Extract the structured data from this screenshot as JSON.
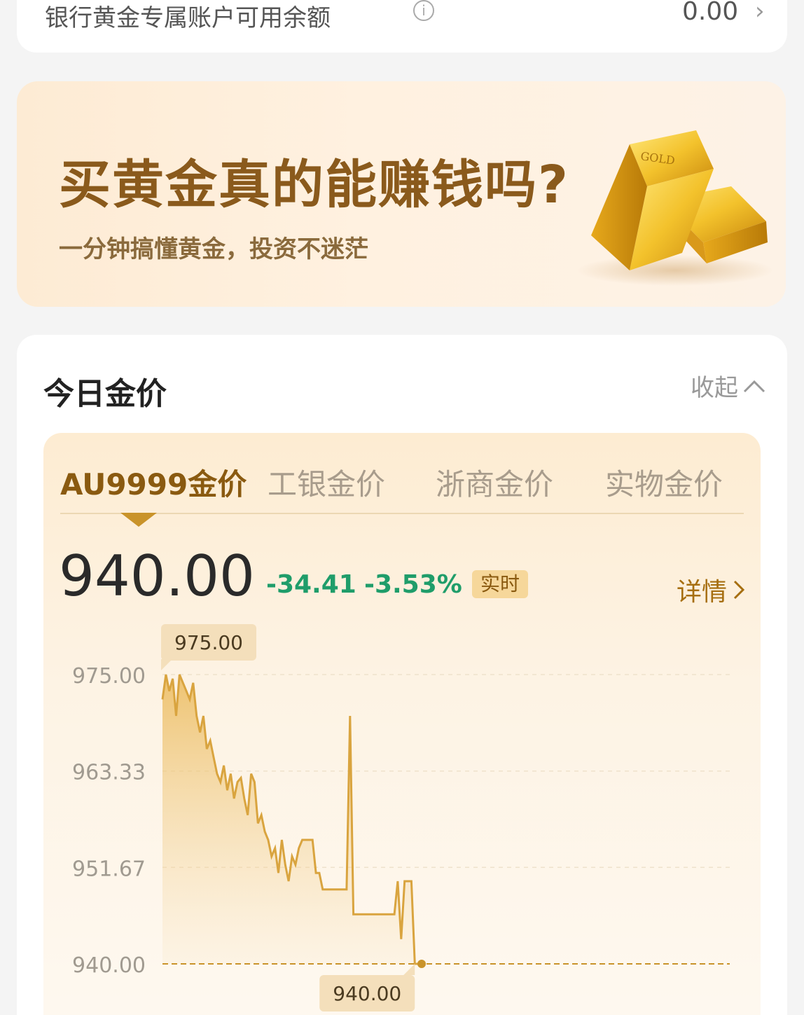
{
  "account": {
    "label": "银行黄金专属账户可用余额",
    "info_icon": "info-icon",
    "value": "0.00",
    "chevron": "chevron-right-icon"
  },
  "banner": {
    "title": "买黄金真的能赚钱吗?",
    "subtitle": "一分钟搞懂黄金，投资不迷茫",
    "image_text": "GOLD",
    "image_icon": "gold-bars-icon"
  },
  "gold_price": {
    "heading": "今日金价",
    "collapse_label": "收起",
    "collapse_icon": "chevron-up-icon",
    "tabs": [
      {
        "label": "AU9999金价",
        "active": true
      },
      {
        "label": "工银金价",
        "active": false
      },
      {
        "label": "浙商金价",
        "active": false
      },
      {
        "label": "实物金价",
        "active": false
      }
    ],
    "price": "940.00",
    "change_abs": "-34.41",
    "change_pct": "-3.53%",
    "realtime_badge": "实时",
    "detail_label": "详情",
    "detail_icon": "chevron-right-icon",
    "colors": {
      "accent": "#c9932a",
      "down": "#1f9d6a",
      "line": "#d9a43f"
    }
  },
  "chart_data": {
    "type": "area",
    "yticks": [
      "975.00",
      "963.33",
      "951.67",
      "940.00"
    ],
    "ylim": [
      940.0,
      975.0
    ],
    "max_label": "975.00",
    "min_label": "940.00",
    "current_value": 940.0,
    "grid": true,
    "values": [
      972,
      975,
      973,
      974.5,
      970,
      975,
      974,
      973,
      972,
      974,
      970,
      968,
      970,
      966,
      967,
      965,
      963,
      962,
      964,
      961,
      963,
      960,
      962,
      962.5,
      960,
      958,
      963,
      962,
      957,
      958,
      956,
      955,
      953,
      954,
      951,
      955,
      952,
      950,
      953,
      952,
      954,
      955,
      955,
      955,
      955,
      951,
      951,
      949,
      949,
      949,
      949,
      949,
      949,
      949,
      949,
      970,
      946,
      946,
      946,
      946,
      946,
      946,
      946,
      946,
      946,
      946,
      946,
      946,
      946,
      950,
      943,
      950,
      950,
      950,
      940,
      940,
      940
    ]
  }
}
